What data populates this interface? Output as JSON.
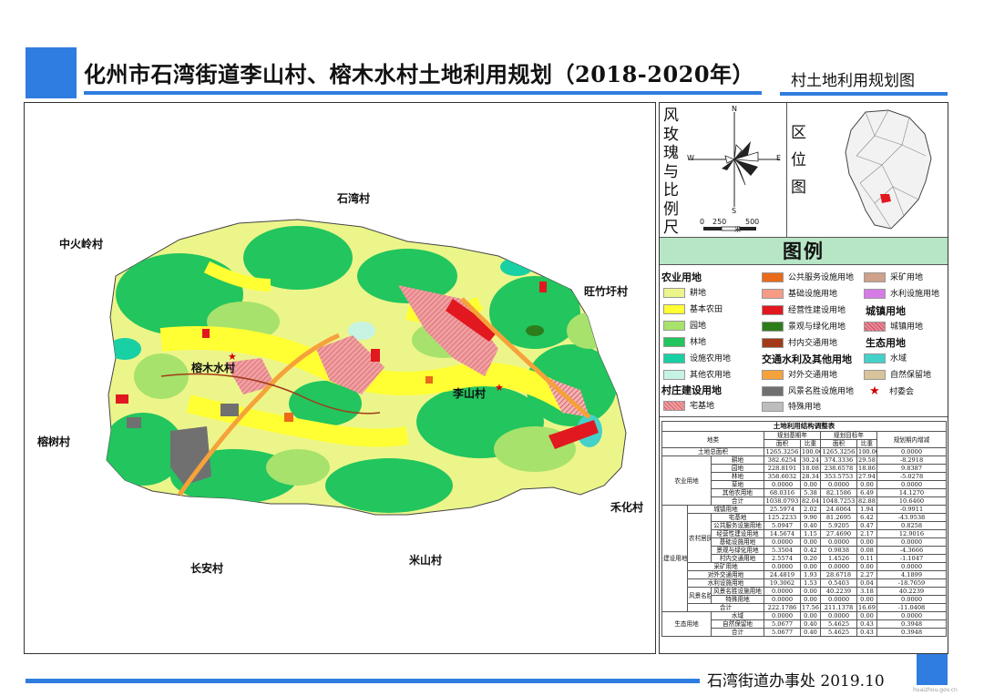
{
  "header": {
    "title": "化州市石湾街道李山村、榕木水村土地利用规划（2018-2020年）",
    "subtitle": "村土地利用规划图"
  },
  "footer": {
    "issuer_date": "石湾街道办事处 2019.10",
    "watermark": "huaizhou.gov.cn"
  },
  "map": {
    "labels": {
      "shiwan": "石湾村",
      "zhonghuoling": "中火岭村",
      "wangzhuyu": "旺竹圩村",
      "rongmushui": "榕木水村",
      "lishan": "李山村",
      "rongshu": "榕树村",
      "hehua": "禾化村",
      "changan": "长安村",
      "mishan": "米山村"
    }
  },
  "compass": {
    "title": "风玫瑰与比例尺",
    "n": "N",
    "s": "S",
    "e": "E",
    "w": "W",
    "scale_0": "0",
    "scale_250": "250",
    "scale_500": "500",
    "scale_unit": "米"
  },
  "location": {
    "title": "区位图"
  },
  "legend": {
    "title": "图例",
    "categories": {
      "agri": "农业用地",
      "village_build": "村庄建设用地",
      "transport": "交通水利及其他用地",
      "town": "城镇用地",
      "eco": "生态用地"
    },
    "items": {
      "gengdi": "耕地",
      "jibennongtian": "基本农田",
      "yuandi": "园地",
      "lindi": "林地",
      "sheshi": "设施农用地",
      "qitanong": "其他农用地",
      "zhaijidi": "宅基地",
      "gonggong": "公共服务设施用地",
      "jichu": "基础设施用地",
      "jingying": "经营性建设用地",
      "jingguan": "景观与绿化用地",
      "cunnei": "村内交通用地",
      "duiwai": "对外交通用地",
      "fengjing": "风景名胜设施用地",
      "teshu": "特殊用地",
      "caikuang": "采矿用地",
      "shuili": "水利设施用地",
      "chengzhen": "城镇用地",
      "shuiyu": "水域",
      "ziran": "自然保留地",
      "cunweihui": "村委会"
    }
  },
  "colors": {
    "brand_blue": "#2f7de0",
    "gengdi": "#ecf58a",
    "jibennongtian": "#ffff33",
    "yuandi": "#a7e26c",
    "lindi": "#22c55e",
    "sheshi": "#19d0a4",
    "qitanong": "#c7f3e3",
    "zhaijidi": "#f0a0a0",
    "gonggong": "#ea6a1a",
    "jichu": "#f59b86",
    "jingying": "#e1181f",
    "jingguan": "#2e7d1c",
    "cunnei": "#a33b1a",
    "duiwai": "#f6a23a",
    "fengjing": "#707070",
    "teshu": "#bdbdbd",
    "caikuang": "#cfa08a",
    "shuili": "#d67be6",
    "chengzhen": "#d25a6a",
    "shuiyu": "#44d1c9",
    "ziran": "#d8c39a"
  },
  "table": {
    "title": "土地利用结构调整表",
    "headers": {
      "dilei": "地类",
      "base_year": "规划基期年",
      "target_year": "规划目标年",
      "change": "规划期内增减",
      "area": "面积",
      "ratio": "比重"
    },
    "rows": [
      {
        "g1": "土地总面积",
        "g2": "",
        "g3": "",
        "v": [
          "1265.3256",
          "100.00",
          "1265.3256",
          "100.00",
          "0.0000"
        ]
      },
      {
        "g1": "农业用地",
        "g2": "",
        "g3": "耕地",
        "v": [
          "382.6254",
          "30.24",
          "374.3336",
          "29.58",
          "-8.2918"
        ]
      },
      {
        "g1": "",
        "g2": "",
        "g3": "园地",
        "v": [
          "228.8191",
          "18.08",
          "238.6578",
          "18.86",
          "9.8387"
        ]
      },
      {
        "g1": "",
        "g2": "",
        "g3": "林地",
        "v": [
          "358.6032",
          "28.34",
          "353.5753",
          "27.94",
          "-5.0278"
        ]
      },
      {
        "g1": "",
        "g2": "",
        "g3": "草地",
        "v": [
          "0.0000",
          "0.00",
          "0.0000",
          "0.00",
          "0.0000"
        ]
      },
      {
        "g1": "",
        "g2": "",
        "g3": "其他农用地",
        "v": [
          "68.0316",
          "5.38",
          "82.1586",
          "6.49",
          "14.1270"
        ]
      },
      {
        "g1": "",
        "g2": "",
        "g3": "合计",
        "v": [
          "1038.0793",
          "82.04",
          "1048.7253",
          "82.88",
          "10.6460"
        ]
      },
      {
        "g1": "建设用地",
        "g2": "",
        "g3": "城镇用地",
        "v": [
          "25.5974",
          "2.02",
          "24.6064",
          "1.94",
          "-0.9911"
        ]
      },
      {
        "g1": "",
        "g2": "农村居民点",
        "g3": "宅基地",
        "v": [
          "125.2233",
          "9.90",
          "81.2695",
          "6.42",
          "-43.9538"
        ]
      },
      {
        "g1": "",
        "g2": "",
        "g3": "公共服务设施用地",
        "v": [
          "5.0947",
          "0.40",
          "5.9205",
          "0.47",
          "0.8258"
        ]
      },
      {
        "g1": "",
        "g2": "",
        "g3": "经营性建设用地",
        "v": [
          "14.5674",
          "1.15",
          "27.4690",
          "2.17",
          "12.9016"
        ]
      },
      {
        "g1": "",
        "g2": "",
        "g3": "基础设施用地",
        "v": [
          "0.0000",
          "0.00",
          "0.0000",
          "0.00",
          "0.0000"
        ]
      },
      {
        "g1": "",
        "g2": "",
        "g3": "景观与绿化用地",
        "v": [
          "5.3504",
          "0.42",
          "0.9838",
          "0.08",
          "-4.3666"
        ]
      },
      {
        "g1": "",
        "g2": "",
        "g3": "村内交通用地",
        "v": [
          "2.5574",
          "0.20",
          "1.4526",
          "0.11",
          "-1.1047"
        ]
      },
      {
        "g1": "",
        "g2": "",
        "g3": "采矿用地",
        "v": [
          "0.0000",
          "0.00",
          "0.0000",
          "0.00",
          "0.0000"
        ]
      },
      {
        "g1": "",
        "g2": "",
        "g3": "对外交通用地",
        "v": [
          "24.4819",
          "1.93",
          "28.6718",
          "2.27",
          "4.1899"
        ]
      },
      {
        "g1": "",
        "g2": "",
        "g3": "水利设施用地",
        "v": [
          "19.3062",
          "1.53",
          "0.5403",
          "0.04",
          "-18.7659"
        ]
      },
      {
        "g1": "",
        "g2": "风景名胜及特殊用地",
        "g3": "风景名胜设施用地",
        "v": [
          "0.0000",
          "0.00",
          "40.2239",
          "3.18",
          "40.2239"
        ]
      },
      {
        "g1": "",
        "g2": "",
        "g3": "特殊用地",
        "v": [
          "0.0000",
          "0.00",
          "0.0000",
          "0.00",
          "0.0000"
        ]
      },
      {
        "g1": "",
        "g2": "",
        "g3": "合计",
        "v": [
          "222.1786",
          "17.56",
          "211.1378",
          "16.69",
          "-11.0408"
        ]
      },
      {
        "g1": "生态用地",
        "g2": "",
        "g3": "水域",
        "v": [
          "0.0000",
          "0.00",
          "0.0000",
          "0.00",
          "0.0000"
        ]
      },
      {
        "g1": "",
        "g2": "",
        "g3": "自然保留地",
        "v": [
          "5.0677",
          "0.40",
          "5.4625",
          "0.43",
          "0.3948"
        ]
      },
      {
        "g1": "",
        "g2": "",
        "g3": "合计",
        "v": [
          "5.0677",
          "0.40",
          "5.4625",
          "0.43",
          "0.3948"
        ]
      }
    ]
  }
}
